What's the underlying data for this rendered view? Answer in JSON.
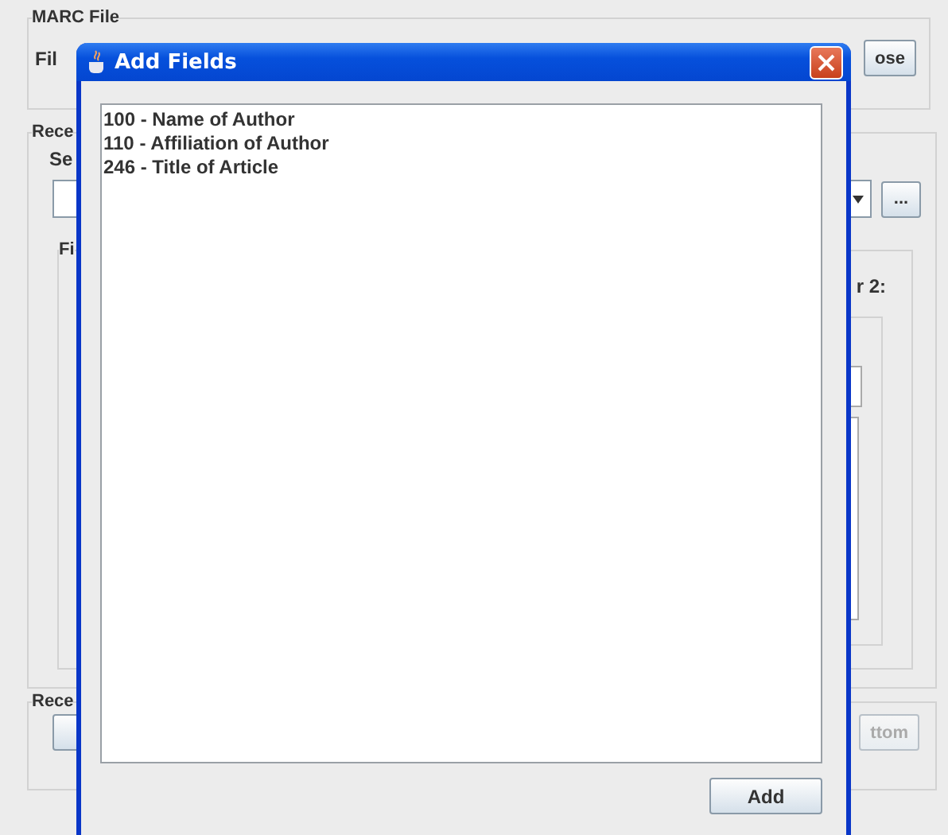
{
  "background": {
    "marc_group_title": "MARC File",
    "file_label": "Fil",
    "choose_button": "ose",
    "record_group_title": "Rece",
    "select_label": "Se",
    "browse_button": "...",
    "fields_group_title": "Fi",
    "indicator_label": "r 2:",
    "bottom_group_title": "Rece",
    "bottom_button": {
      "label": "ttom",
      "disabled": true
    }
  },
  "dialog": {
    "title": "Add Fields",
    "fields": [
      "100 - Name of Author",
      "110 - Affiliation of Author",
      "246 - Title of Article"
    ],
    "add_button": "Add"
  }
}
